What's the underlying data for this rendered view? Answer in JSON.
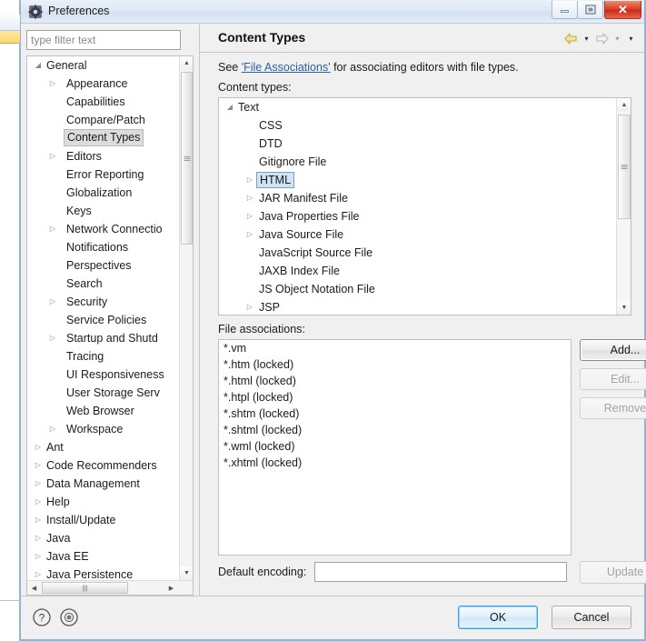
{
  "window": {
    "title": "Preferences",
    "icon": "gear-icon",
    "controls": {
      "minimize": "–",
      "maximize": "□",
      "close": "✕"
    }
  },
  "filter": {
    "placeholder": "type filter text",
    "value": ""
  },
  "sidebar": {
    "items": [
      {
        "label": "General",
        "level": 1,
        "expandable": true,
        "expanded": true,
        "selected": false
      },
      {
        "label": "Appearance",
        "level": 2,
        "expandable": true,
        "expanded": false,
        "selected": false
      },
      {
        "label": "Capabilities",
        "level": 2,
        "expandable": false,
        "expanded": false,
        "selected": false
      },
      {
        "label": "Compare/Patch",
        "level": 2,
        "expandable": false,
        "expanded": false,
        "selected": false
      },
      {
        "label": "Content Types",
        "level": 2,
        "expandable": false,
        "expanded": false,
        "selected": true
      },
      {
        "label": "Editors",
        "level": 2,
        "expandable": true,
        "expanded": false,
        "selected": false
      },
      {
        "label": "Error Reporting",
        "level": 2,
        "expandable": false,
        "expanded": false,
        "selected": false
      },
      {
        "label": "Globalization",
        "level": 2,
        "expandable": false,
        "expanded": false,
        "selected": false
      },
      {
        "label": "Keys",
        "level": 2,
        "expandable": false,
        "expanded": false,
        "selected": false
      },
      {
        "label": "Network Connectio",
        "level": 2,
        "expandable": true,
        "expanded": false,
        "selected": false
      },
      {
        "label": "Notifications",
        "level": 2,
        "expandable": false,
        "expanded": false,
        "selected": false
      },
      {
        "label": "Perspectives",
        "level": 2,
        "expandable": false,
        "expanded": false,
        "selected": false
      },
      {
        "label": "Search",
        "level": 2,
        "expandable": false,
        "expanded": false,
        "selected": false
      },
      {
        "label": "Security",
        "level": 2,
        "expandable": true,
        "expanded": false,
        "selected": false
      },
      {
        "label": "Service Policies",
        "level": 2,
        "expandable": false,
        "expanded": false,
        "selected": false
      },
      {
        "label": "Startup and Shutd",
        "level": 2,
        "expandable": true,
        "expanded": false,
        "selected": false
      },
      {
        "label": "Tracing",
        "level": 2,
        "expandable": false,
        "expanded": false,
        "selected": false
      },
      {
        "label": "UI Responsiveness",
        "level": 2,
        "expandable": false,
        "expanded": false,
        "selected": false
      },
      {
        "label": "User Storage Serv",
        "level": 2,
        "expandable": false,
        "expanded": false,
        "selected": false
      },
      {
        "label": "Web Browser",
        "level": 2,
        "expandable": false,
        "expanded": false,
        "selected": false
      },
      {
        "label": "Workspace",
        "level": 2,
        "expandable": true,
        "expanded": false,
        "selected": false
      },
      {
        "label": "Ant",
        "level": 1,
        "expandable": true,
        "expanded": false,
        "selected": false
      },
      {
        "label": "Code Recommenders",
        "level": 1,
        "expandable": true,
        "expanded": false,
        "selected": false
      },
      {
        "label": "Data Management",
        "level": 1,
        "expandable": true,
        "expanded": false,
        "selected": false
      },
      {
        "label": "Help",
        "level": 1,
        "expandable": true,
        "expanded": false,
        "selected": false
      },
      {
        "label": "Install/Update",
        "level": 1,
        "expandable": true,
        "expanded": false,
        "selected": false
      },
      {
        "label": "Java",
        "level": 1,
        "expandable": true,
        "expanded": false,
        "selected": false
      },
      {
        "label": "Java EE",
        "level": 1,
        "expandable": true,
        "expanded": false,
        "selected": false
      },
      {
        "label": "Java Persistence",
        "level": 1,
        "expandable": true,
        "expanded": false,
        "selected": false
      }
    ]
  },
  "page": {
    "title": "Content Types",
    "description_prefix": "See ",
    "description_link": "'File Associations'",
    "description_suffix": " for associating editors with file types.",
    "content_types_label": "Content types:",
    "nav": {
      "back_icon": "back-arrow-icon",
      "forward_icon": "forward-arrow-icon",
      "chevron": "▾"
    }
  },
  "content_types": {
    "nodes": [
      {
        "label": "Text",
        "level": 1,
        "expandable": true,
        "expanded": true,
        "selected": false
      },
      {
        "label": "CSS",
        "level": 2,
        "expandable": false,
        "expanded": false,
        "selected": false
      },
      {
        "label": "DTD",
        "level": 2,
        "expandable": false,
        "expanded": false,
        "selected": false
      },
      {
        "label": "Gitignore File",
        "level": 2,
        "expandable": false,
        "expanded": false,
        "selected": false
      },
      {
        "label": "HTML",
        "level": 2,
        "expandable": true,
        "expanded": false,
        "selected": true
      },
      {
        "label": "JAR Manifest File",
        "level": 2,
        "expandable": true,
        "expanded": false,
        "selected": false
      },
      {
        "label": "Java Properties File",
        "level": 2,
        "expandable": true,
        "expanded": false,
        "selected": false
      },
      {
        "label": "Java Source File",
        "level": 2,
        "expandable": true,
        "expanded": false,
        "selected": false
      },
      {
        "label": "JavaScript Source File",
        "level": 2,
        "expandable": false,
        "expanded": false,
        "selected": false
      },
      {
        "label": "JAXB Index File",
        "level": 2,
        "expandable": false,
        "expanded": false,
        "selected": false
      },
      {
        "label": "JS Object Notation File",
        "level": 2,
        "expandable": false,
        "expanded": false,
        "selected": false
      },
      {
        "label": "JSP",
        "level": 2,
        "expandable": true,
        "expanded": false,
        "selected": false
      }
    ]
  },
  "file_associations": {
    "label": "File associations:",
    "items": [
      "*.vm",
      "*.htm (locked)",
      "*.html (locked)",
      "*.htpl (locked)",
      "*.shtm (locked)",
      "*.shtml (locked)",
      "*.wml (locked)",
      "*.xhtml (locked)"
    ],
    "buttons": {
      "add": "Add...",
      "edit": "Edit...",
      "remove": "Remove"
    }
  },
  "encoding": {
    "label": "Default encoding:",
    "value": "",
    "update_button": "Update"
  },
  "footer": {
    "help_icon": "question-mark-icon",
    "secondary_icon": "apply-defaults-icon",
    "ok": "OK",
    "cancel": "Cancel"
  },
  "colors": {
    "link": "#2b5fa8",
    "selection_fill": "#cfe3f5",
    "selection_border": "#7a9fc4",
    "tree_selection": "#dcdcdc",
    "default_button_border": "#3c9cd4",
    "close_button": "#d9412a"
  }
}
